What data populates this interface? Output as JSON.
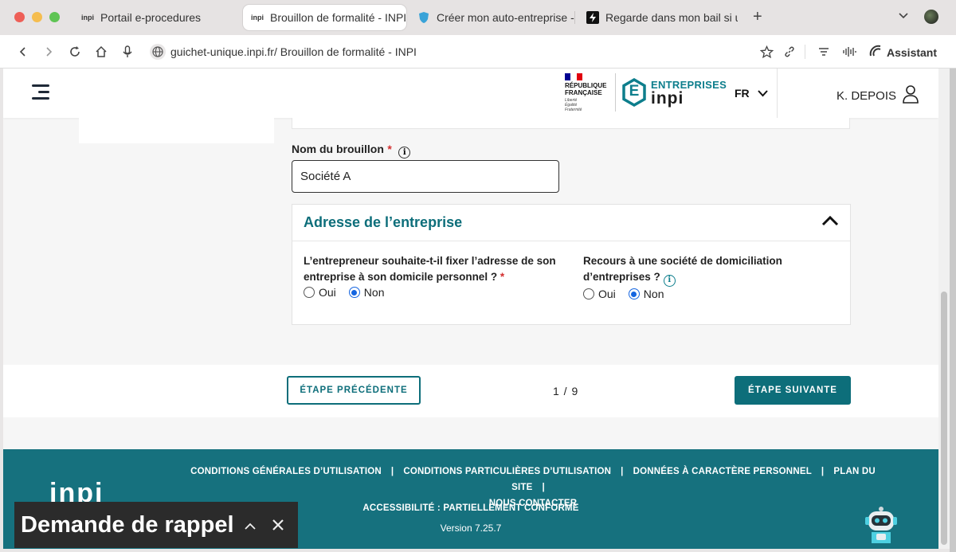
{
  "browser": {
    "tabs": [
      {
        "favicon": "inpi",
        "title": "Portail e-procedures"
      },
      {
        "favicon": "inpi",
        "title": "Brouillon de formalité - INPI"
      },
      {
        "favicon": "shield",
        "title": "Créer mon auto-entreprise -"
      },
      {
        "favicon": "bolt",
        "title": "Regarde dans mon bail si un"
      }
    ],
    "new_tab": "+",
    "url_domain": "guichet-unique.inpi.fr",
    "url_title": " / Brouillon de formalité - INPI",
    "assistant": "Assistant"
  },
  "header": {
    "rf_line1": "RÉPUBLIQUE",
    "rf_line2": "FRANÇAISE",
    "devise_1": "Liberté",
    "devise_2": "Égalité",
    "devise_3": "Fraternité",
    "hex_letter": "E",
    "brand_top": "ENTREPRISES",
    "brand_bottom": "inpi",
    "lang": "FR",
    "user": "K. DEPOIS"
  },
  "form": {
    "draft_label": "Nom du brouillon",
    "required_mark": "*",
    "info_glyph": "i",
    "draft_value": "Société A",
    "address_section": {
      "title": "Adresse de l’entreprise",
      "q1_line1": "L’entrepreneur souhaite-t-il fixer l’adresse de son",
      "q1_line2": "entreprise à son domicile personnel ?",
      "q2_line1": "Recours à une société de domiciliation",
      "q2_line2": "d’entreprises ?",
      "opt_yes": "Oui",
      "opt_no": "Non",
      "q1_selected": "Non",
      "q2_selected": "Non"
    }
  },
  "steps": {
    "prev": "ÉTAPE PRÉCÉDENTE",
    "counter": "1 / 9",
    "next": "ÉTAPE SUIVANTE"
  },
  "footer": {
    "links": [
      "CONDITIONS GÉNÉRALES D’UTILISATION",
      "CONDITIONS PARTICULIÈRES D’UTILISATION",
      "DONNÉES À CARACTÈRE PERSONNEL",
      "PLAN DU SITE"
    ],
    "contact": "NOUS CONTACTER",
    "separator": "|",
    "accessibility": "ACCESSIBILITÉ : PARTIELLEMENT CONFORME",
    "version": "Version 7.25.7",
    "logo": "inpi"
  },
  "callback": {
    "label": "Demande de rappel",
    "expand_glyph": "^",
    "close_glyph": "✕"
  },
  "colors": {
    "teal": "#0d6e7a",
    "footer": "#16717e",
    "required": "#d32f2f",
    "radio": "#1565e0"
  }
}
